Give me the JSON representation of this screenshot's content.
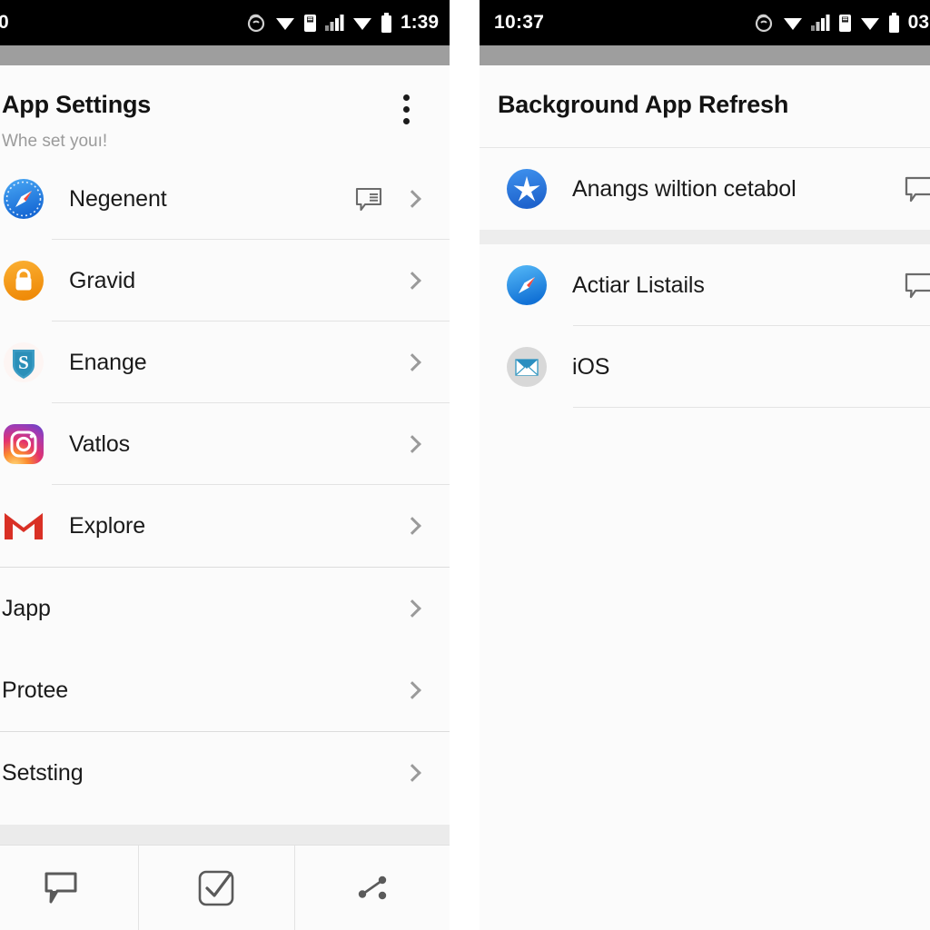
{
  "left_panel": {
    "status_bar": {
      "clock_left": "0",
      "clock_right": "1:39",
      "icons": [
        "ringer-icon",
        "wifi-icon",
        "sim-card-icon",
        "signal-icon",
        "wifi-icon",
        "battery-icon"
      ]
    },
    "header": {
      "title": "App Settings",
      "subtitle": "Whe set youı!",
      "overflow_menu": "kebab-menu-icon"
    },
    "group_one": [
      {
        "label": "Negenent",
        "icon": "safari-compass-icon",
        "badge": "speech-bubble-lines-icon",
        "chevron": true
      },
      {
        "label": "Gravid",
        "icon": "orange-lock-icon",
        "badge": null,
        "chevron": true
      },
      {
        "label": "Enange",
        "icon": "blue-shield-s-icon",
        "badge": null,
        "chevron": true
      },
      {
        "label": "Vatlos",
        "icon": "instagram-icon",
        "badge": null,
        "chevron": true
      },
      {
        "label": "Explore",
        "icon": "gmail-icon",
        "badge": null,
        "chevron": true
      }
    ],
    "group_two": [
      {
        "label": "Japp",
        "icon": null,
        "chevron": true
      },
      {
        "label": "Protee",
        "icon": null,
        "chevron": true
      }
    ],
    "group_three": [
      {
        "label": "Setsting",
        "icon": null,
        "chevron": true
      }
    ],
    "tabbar": [
      {
        "name": "chat-bubble-tab",
        "icon": "speech-bubble-icon"
      },
      {
        "name": "tasks-tab",
        "icon": "check-square-icon"
      },
      {
        "name": "share-tab",
        "icon": "share-nodes-icon"
      }
    ]
  },
  "right_panel": {
    "status_bar": {
      "clock_left": "10:37",
      "clock_right": "03:",
      "icons": [
        "ringer-icon",
        "wifi-icon",
        "signal-icon",
        "sim-card-icon",
        "wifi-icon",
        "battery-icon"
      ]
    },
    "header": {
      "title": "Background App Refresh"
    },
    "group_one": [
      {
        "label": "Anangs wiltion cetabol",
        "icon": "blue-star-icon",
        "badge": "speech-bubble-icon"
      }
    ],
    "group_two": [
      {
        "label": "Actiar Listails",
        "icon": "safari-compass-icon",
        "badge": "speech-bubble-icon"
      },
      {
        "label": "iOS",
        "icon": "grey-mail-icon",
        "badge": null
      }
    ]
  },
  "colors": {
    "status_bar_bg": "#000000",
    "grey_band": "#9e9e9e",
    "surface": "#fbfbfb",
    "title_text": "#131313",
    "subtitle_text": "#9b9b9b",
    "row_text": "#1a1a1a",
    "chevron": "#9a9a9a",
    "divider": "#e3e3e3",
    "group_gap": "#ededed",
    "safari_blue": "#2f8ced",
    "lock_orange": "#f0990f",
    "shield_blue": "#2b8fb8",
    "gmail_red": "#d93025",
    "star_blue": "#2979e0"
  }
}
